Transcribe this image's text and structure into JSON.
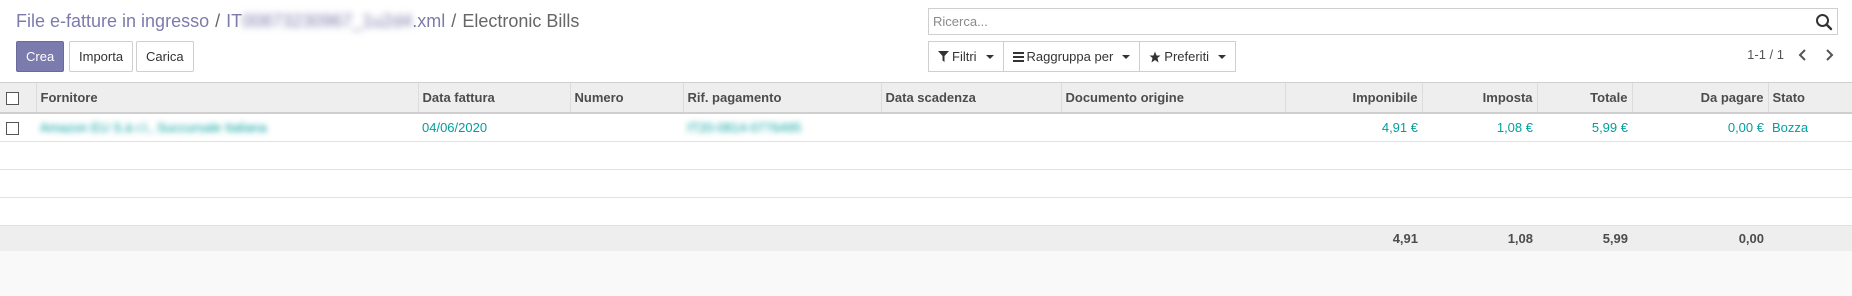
{
  "breadcrumb": {
    "root": "File e-fatture in ingresso",
    "file_prefix": "IT",
    "file_blurred": "00873230967_1u2d4",
    "file_suffix": ".xml",
    "current": "Electronic Bills",
    "separator": "/"
  },
  "buttons": {
    "create": "Crea",
    "import": "Importa",
    "upload": "Carica"
  },
  "search": {
    "placeholder": "Ricerca...",
    "value": ""
  },
  "filters": {
    "filter_label": "Filtri",
    "groupby_label": "Raggruppa per",
    "favorites_label": "Preferiti"
  },
  "pager": {
    "value": "1-1 / 1"
  },
  "table": {
    "columns": [
      "Fornitore",
      "Data fattura",
      "Numero",
      "Rif. pagamento",
      "Data scadenza",
      "Documento origine",
      "Imponibile",
      "Imposta",
      "Totale",
      "Da pagare",
      "Stato"
    ],
    "rows": [
      {
        "fornitore": "Amazon EU S.à r.l., Succursale Italiana",
        "data_fattura": "04/06/2020",
        "numero": "",
        "rif_pagamento": "IT20-0814-0776495",
        "data_scadenza": "",
        "documento_origine": "",
        "imponibile": "4,91 €",
        "imposta": "1,08 €",
        "totale": "5,99 €",
        "da_pagare": "0,00 €",
        "stato": "Bozza"
      }
    ],
    "totals": {
      "imponibile": "4,91",
      "imposta": "1,08",
      "totale": "5,99",
      "da_pagare": "0,00"
    }
  },
  "colors": {
    "primary": "#7c7bad",
    "link": "#00a09d"
  }
}
